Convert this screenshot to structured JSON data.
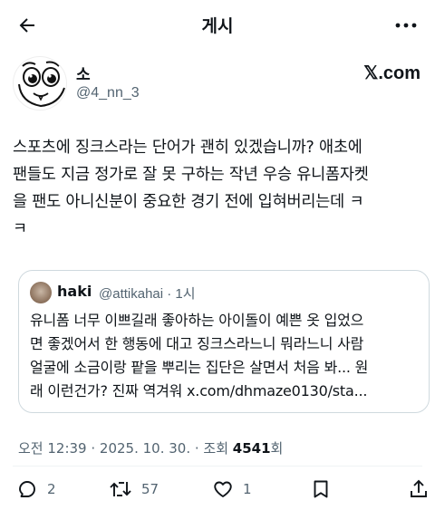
{
  "header": {
    "title": "게시",
    "back_icon": "arrow-left-icon",
    "more_icon": "more-horizontal-icon"
  },
  "author": {
    "display_name": "소",
    "handle": "@4_nn_3",
    "source_logo": "𝕏.com"
  },
  "tweet": {
    "text": "스포츠에 징크스라는 단어가 괜히 있겠습니까?   애초에\n팬들도 지금 정가로 잘 못 구하는 작년 우승 유니폼자켓\n을 팬도 아니신분이 중요한 경기 전에 입혀버리는데 ㅋ\nㅋ"
  },
  "quote": {
    "name": "haki",
    "handle_time": "@attikahai · 1시",
    "text": "유니폼 너무 이쁘길래 좋아하는 아이돌이 예쁜 옷 입었으\n면 좋겠어서 한 행동에 대고 징크스라느니 뭐라느니 사람\n얼굴에 소금이랑 팥을 뿌리는 집단은 살면서 처음 봐... 원\n래 이런건가? 진짜 역겨워 x.com/dhmaze0130/sta..."
  },
  "meta": {
    "timestamp": "오전 12:39 · 2025. 10. 30. · 조회 ",
    "views": "4541",
    "views_suffix": "회"
  },
  "actions": {
    "reply_count": "2",
    "retweet_count": "57",
    "like_count": "1",
    "icons": [
      "reply-icon",
      "retweet-icon",
      "like-icon",
      "bookmark-icon",
      "share-icon"
    ]
  },
  "colors": {
    "text": "#0f1419",
    "secondary": "#536471",
    "border": "#cfd9de"
  }
}
